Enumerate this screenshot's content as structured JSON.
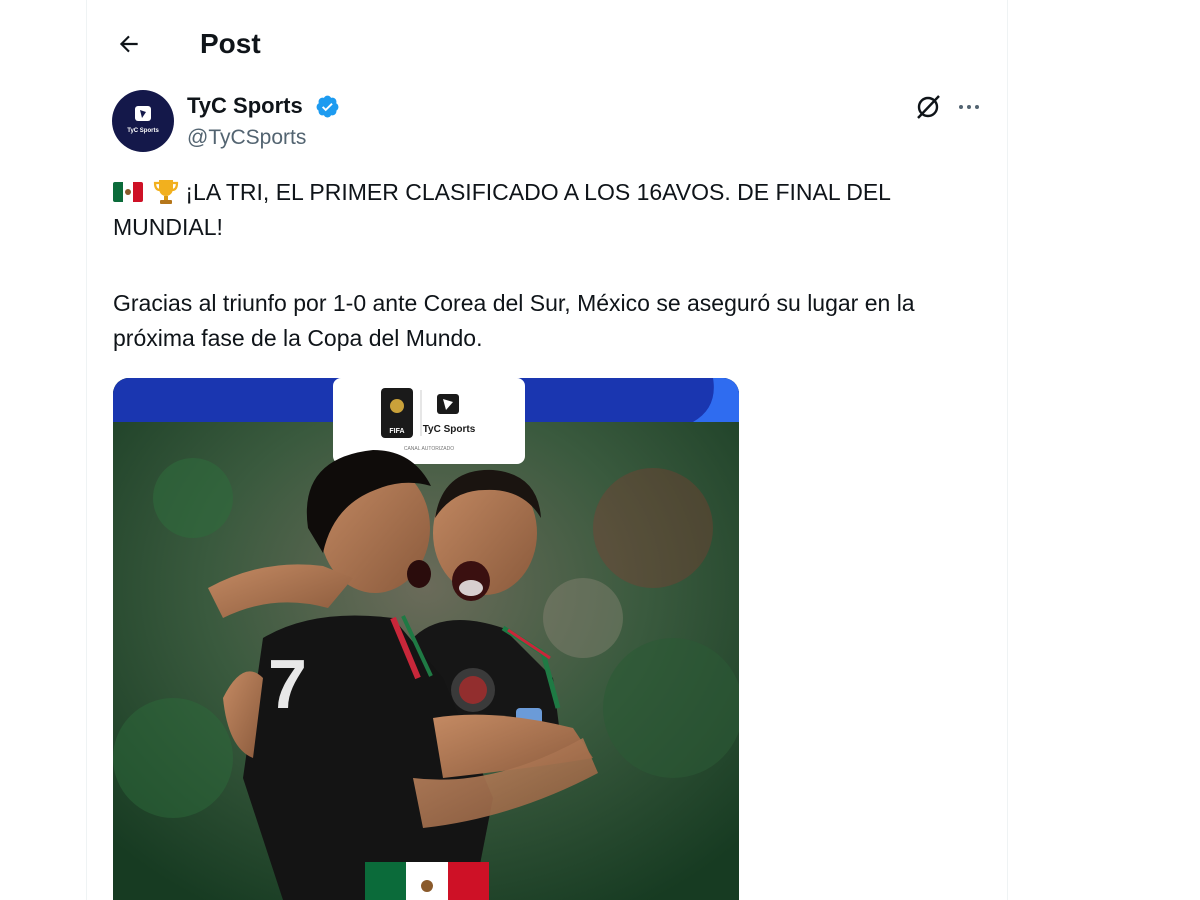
{
  "header": {
    "title": "Post"
  },
  "author": {
    "name": "TyC Sports",
    "handle": "@TyCSports",
    "verified": true,
    "avatar_text": "TyC Sports"
  },
  "post": {
    "headline": "¡LA TRI, EL PRIMER CLASIFICADO A LOS 16AVOS. DE FINAL DEL MUNDIAL!",
    "body": "Gracias al triunfo por 1-0 ante Corea del Sur, México se aseguró su lugar en la próxima fase de la Copa del Mundo.",
    "emojis": [
      "mexico-flag",
      "trophy"
    ]
  },
  "media": {
    "logo_text": "TyC Sports",
    "logo_subtext": "CANAL AUTORIZADO",
    "fifa_text": "FIFA",
    "jersey_number": "7"
  },
  "colors": {
    "brand_navy": "#14184a",
    "verified_blue": "#1d9bf0",
    "banner_blue": "#1a36b0"
  },
  "icons": [
    "back-arrow-icon",
    "verified-badge-icon",
    "grok-icon",
    "more-icon"
  ]
}
